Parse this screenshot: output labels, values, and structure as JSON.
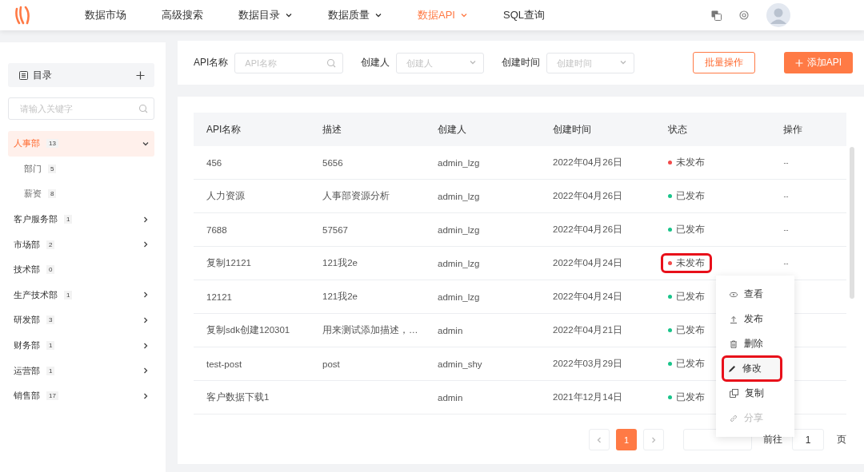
{
  "nav": {
    "items": [
      {
        "label": "数据市场",
        "selected": false,
        "dropdown": false
      },
      {
        "label": "高级搜索",
        "selected": false,
        "dropdown": false
      },
      {
        "label": "数据目录",
        "selected": false,
        "dropdown": true
      },
      {
        "label": "数据质量",
        "selected": false,
        "dropdown": true
      },
      {
        "label": "数据API",
        "selected": true,
        "dropdown": true
      },
      {
        "label": "SQL查询",
        "selected": false,
        "dropdown": false
      }
    ]
  },
  "sidebar": {
    "title": "目录",
    "search": {
      "placeholder": "请输入关键字"
    },
    "items": [
      {
        "label": "人事部",
        "count": "13",
        "selected": true,
        "expanded": true,
        "has_children": true,
        "children": [
          {
            "label": "部门",
            "count": "5"
          },
          {
            "label": "薪资",
            "count": "8"
          }
        ]
      },
      {
        "label": "客户服务部",
        "count": "1",
        "selected": false,
        "expanded": false,
        "has_children": true
      },
      {
        "label": "市场部",
        "count": "2",
        "selected": false,
        "expanded": false,
        "has_children": true
      },
      {
        "label": "技术部",
        "count": "0",
        "selected": false,
        "expanded": false,
        "has_children": false
      },
      {
        "label": "生产技术部",
        "count": "1",
        "selected": false,
        "expanded": false,
        "has_children": true
      },
      {
        "label": "研发部",
        "count": "3",
        "selected": false,
        "expanded": false,
        "has_children": true
      },
      {
        "label": "财务部",
        "count": "1",
        "selected": false,
        "expanded": false,
        "has_children": true
      },
      {
        "label": "运营部",
        "count": "1",
        "selected": false,
        "expanded": false,
        "has_children": true
      },
      {
        "label": "销售部",
        "count": "17",
        "selected": false,
        "expanded": false,
        "has_children": true
      }
    ]
  },
  "filters": [
    {
      "label": "API名称",
      "placeholder": "API名称",
      "kind": "search"
    },
    {
      "label": "创建人",
      "placeholder": "创建人",
      "kind": "select"
    },
    {
      "label": "创建时间",
      "placeholder": "创建时间",
      "kind": "select"
    }
  ],
  "actions": [
    {
      "label": "批量操作",
      "kind": "outline"
    },
    {
      "label": "添加API",
      "kind": "primary"
    }
  ],
  "table": {
    "columns": [
      "API名称",
      "描述",
      "创建人",
      "创建时间",
      "状态",
      "操作"
    ],
    "rows": [
      {
        "name": "456",
        "description": "5656",
        "creator": "admin_lzg",
        "created": "2022年04月26日",
        "status": "未发布",
        "published": false,
        "highlighted": false,
        "action": "···"
      },
      {
        "name": "人力资源",
        "description": "人事部资源分析",
        "creator": "admin_lzg",
        "created": "2022年04月26日",
        "status": "已发布",
        "published": true,
        "highlighted": false,
        "action": "···"
      },
      {
        "name": "7688",
        "description": "57567",
        "creator": "admin_lzg",
        "created": "2022年04月26日",
        "status": "已发布",
        "published": true,
        "highlighted": false,
        "action": "···"
      },
      {
        "name": "复制12121",
        "description": "121我2e",
        "creator": "admin_lzg",
        "created": "2022年04月24日",
        "status": "未发布",
        "published": false,
        "highlighted": true,
        "action": "···"
      },
      {
        "name": "12121",
        "description": "121我2e",
        "creator": "admin_lzg",
        "created": "2022年04月24日",
        "status": "已发布",
        "published": true,
        "highlighted": false
      },
      {
        "name": "复制sdk创建120301",
        "description": "用来测试添加描述，…",
        "creator": "admin",
        "created": "2022年04月21日",
        "status": "已发布",
        "published": true,
        "highlighted": false
      },
      {
        "name": "test-post",
        "description": "post",
        "creator": "admin_shy",
        "created": "2022年03月29日",
        "status": "已发布",
        "published": true,
        "highlighted": false
      },
      {
        "name": "客户数据下载1",
        "creator": "admin",
        "created": "2021年12月14日",
        "status": "已发布",
        "published": true,
        "highlighted": false
      }
    ]
  },
  "menu": {
    "items": [
      {
        "label": "查看",
        "kind": "view",
        "disabled": false,
        "highlighted": false
      },
      {
        "label": "发布",
        "kind": "publish",
        "disabled": false,
        "highlighted": false
      },
      {
        "label": "删除",
        "kind": "delete",
        "disabled": false,
        "highlighted": false
      },
      {
        "label": "修改",
        "kind": "edit",
        "disabled": false,
        "highlighted": true
      },
      {
        "label": "复制",
        "kind": "copy",
        "disabled": false,
        "highlighted": false
      },
      {
        "label": "分享",
        "kind": "share",
        "disabled": true,
        "highlighted": false
      }
    ]
  },
  "pagination": {
    "pages": [
      {
        "label": "1",
        "selected": true
      }
    ],
    "goto_label": "前往",
    "goto_value": "1",
    "page_unit": "页"
  }
}
